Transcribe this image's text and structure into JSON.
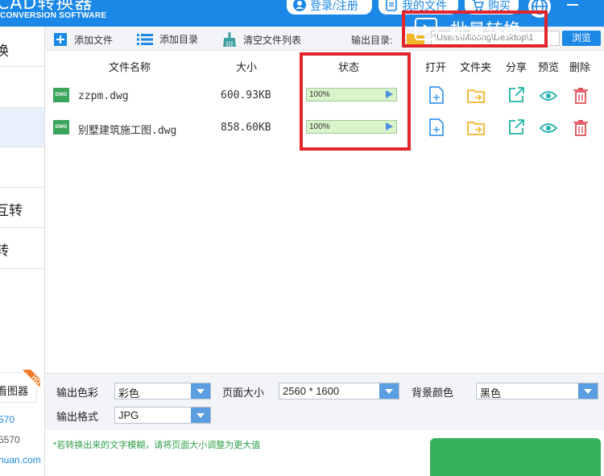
{
  "header": {
    "title": "CAD转换器",
    "subtitle": "CONVERSION SOFTWARE",
    "login_label": "登录/注册",
    "my_files_label": "我的文件",
    "buy_label": "购买"
  },
  "sidebar": {
    "items": [
      {
        "label": "换"
      },
      {
        "label": ""
      },
      {
        "label": ""
      },
      {
        "label": "互转"
      },
      {
        "label": "转"
      },
      {
        "label": ""
      }
    ],
    "promo_label": "看图器",
    "promo_badge": "HOT",
    "contact_1": "570",
    "contact_2": "5570",
    "website": "huan.com"
  },
  "toolbar": {
    "add_file": "添加文件",
    "add_dir": "添加目录",
    "clear_list": "清空文件列表",
    "output_label": "输出目录:",
    "output_path": ":\\Users\\Mloong\\Desktop\\1",
    "browse": "浏览"
  },
  "table": {
    "headers": {
      "name": "文件名称",
      "size": "大小",
      "status": "状态",
      "open": "打开",
      "folder": "文件夹",
      "share": "分享",
      "preview": "预览",
      "delete": "删除"
    },
    "rows": [
      {
        "icon_text": "DWG",
        "name": "zzpm.dwg",
        "size": "600.93KB",
        "status": "100%",
        "progress": 1.0
      },
      {
        "icon_text": "DWG",
        "name": "别墅建筑施工图.dwg",
        "size": "858.60KB",
        "status": "100%",
        "progress": 1.0
      }
    ]
  },
  "options": {
    "color_label": "输出色彩",
    "color_value": "彩色",
    "page_size_label": "页面大小",
    "page_size_value": "2560 * 1600",
    "bg_color_label": "背景颜色",
    "bg_color_value": "黑色",
    "format_label": "输出格式",
    "format_value": "JPG"
  },
  "footer": {
    "tip": "*若转换出来的文字模糊，请将页面大小调整为更大值",
    "convert_label": "批量转换"
  },
  "colors": {
    "accent": "#1b87e6",
    "highlight": "#e1252b",
    "convert": "#35b25a"
  }
}
